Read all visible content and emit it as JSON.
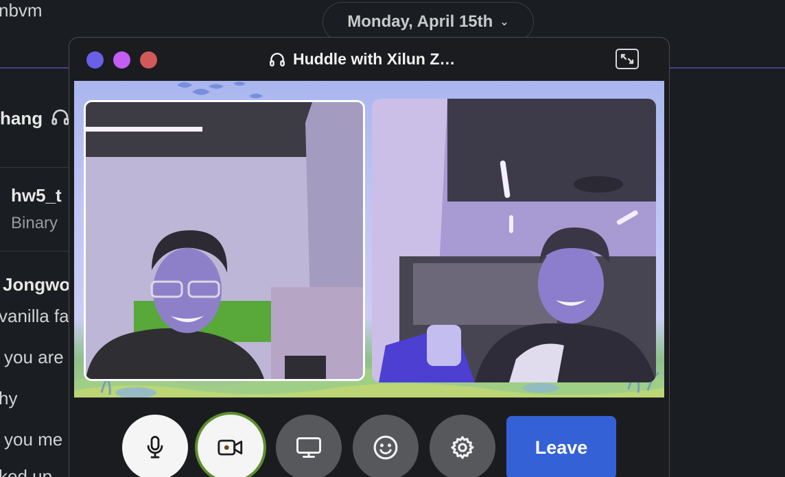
{
  "background": {
    "channel_partial": "nbvm",
    "date_divider": "Monday, April 15th",
    "header_name_partial": "hang",
    "file_name_partial": "hw5_t",
    "file_type": "Binary",
    "sender_partial": "Jongwo",
    "messages": [
      "vanilla fa",
      "you are",
      "hy",
      "you me",
      "ked up"
    ]
  },
  "huddle": {
    "title": "Huddle with Xilun Z…",
    "traffic_colors": [
      "#6a5fe6",
      "#c35ef5",
      "#d05a5a"
    ],
    "leave_label": "Leave",
    "controls": {
      "mic_icon": "microphone-icon",
      "camera_icon": "video-camera-icon",
      "share_icon": "screen-share-icon",
      "emoji_icon": "emoji-icon",
      "settings_icon": "gear-icon"
    },
    "accent_leave": "#3461d6",
    "camera_ring": "#5e8f2e"
  }
}
